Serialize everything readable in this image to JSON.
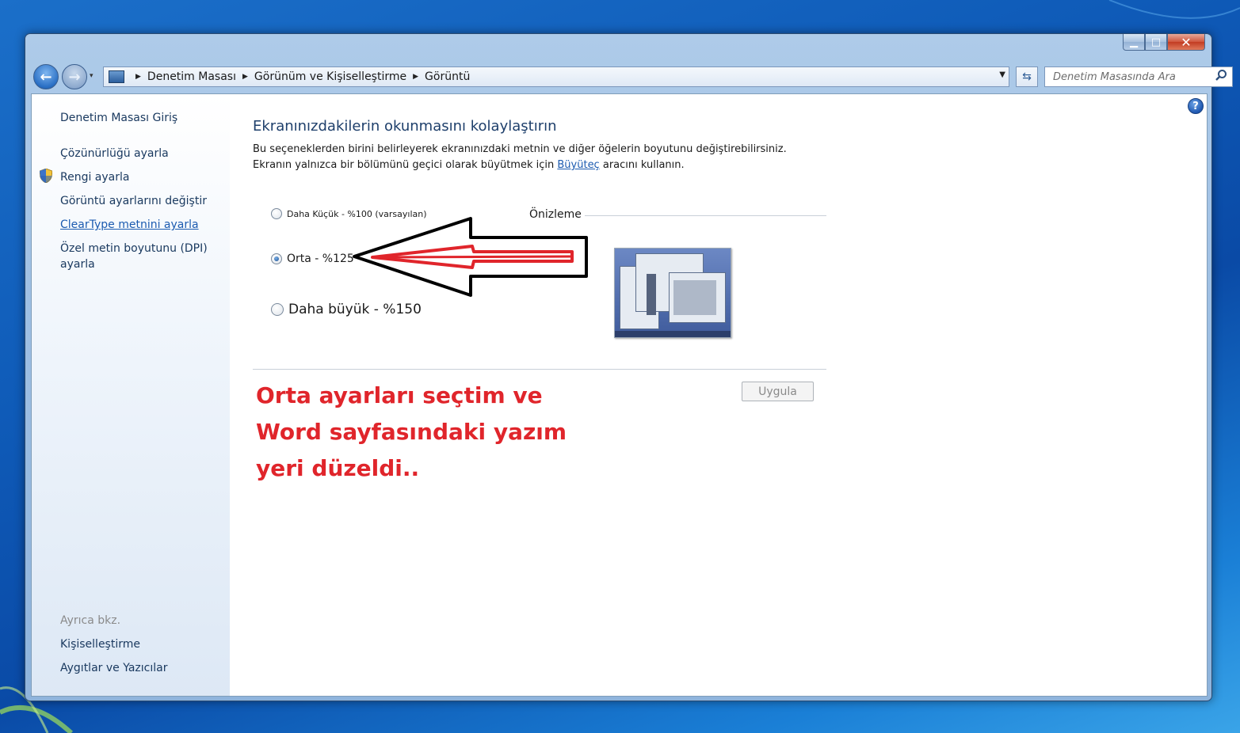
{
  "window": {
    "controls": {
      "minimize": "▁",
      "maximize": "□",
      "close": "✕"
    }
  },
  "navbar": {
    "back": "←",
    "forward": "→",
    "dropdown": "▾",
    "breadcrumb": [
      "Denetim Masası",
      "Görünüm ve Kişiselleştirme",
      "Görüntü"
    ],
    "breadcrumb_separator": "▶",
    "address_dropdown": "▼",
    "refresh": "⇆",
    "search": {
      "placeholder": "Denetim Masasında Ara",
      "value": "",
      "icon": "magnifier"
    }
  },
  "sidebar": {
    "home": "Denetim Masası Giriş",
    "items": [
      {
        "label": "Çözünürlüğü ayarla",
        "style": "normal"
      },
      {
        "label": "Rengi ayarla",
        "style": "normal",
        "icon": "shield"
      },
      {
        "label": "Görüntü ayarlarını değiştir",
        "style": "normal"
      },
      {
        "label": "ClearType metnini ayarla",
        "style": "link"
      },
      {
        "label": "Özel metin boyutunu (DPI) ayarla",
        "style": "normal"
      }
    ],
    "see_also": {
      "heading": "Ayrıca bkz.",
      "items": [
        "Kişiselleştirme",
        "Aygıtlar ve Yazıcılar"
      ]
    }
  },
  "main": {
    "help": "?",
    "title": "Ekranınızdakilerin okunmasını kolaylaştırın",
    "desc_line1": "Bu seçeneklerden birini belirleyerek ekranınızdaki metnin ve diğer öğelerin boyutunu değiştirebilirsiniz.",
    "desc_line2_pre": "Ekranın yalnızca bir bölümünü geçici olarak büyütmek için ",
    "desc_line2_link": "Büyüteç",
    "desc_line2_post": " aracını kullanın.",
    "options": [
      {
        "label": "Daha Küçük - %100 (varsayılan)",
        "checked": false
      },
      {
        "label": "Orta - %125",
        "checked": true
      },
      {
        "label": "Daha büyük - %150",
        "checked": false
      }
    ],
    "preview_label": "Önizleme",
    "apply_button": "Uygula"
  },
  "annotation": {
    "lines": [
      "Orta ayarları seçtim ve",
      "Word sayfasındaki yazım",
      "yeri düzeldi.."
    ],
    "color": "#e0252b"
  },
  "colors": {
    "title": "#1e3f6b",
    "link": "#1c5bb0",
    "arrow_fill": "#e0252b",
    "arrow_outline": "#000000"
  }
}
